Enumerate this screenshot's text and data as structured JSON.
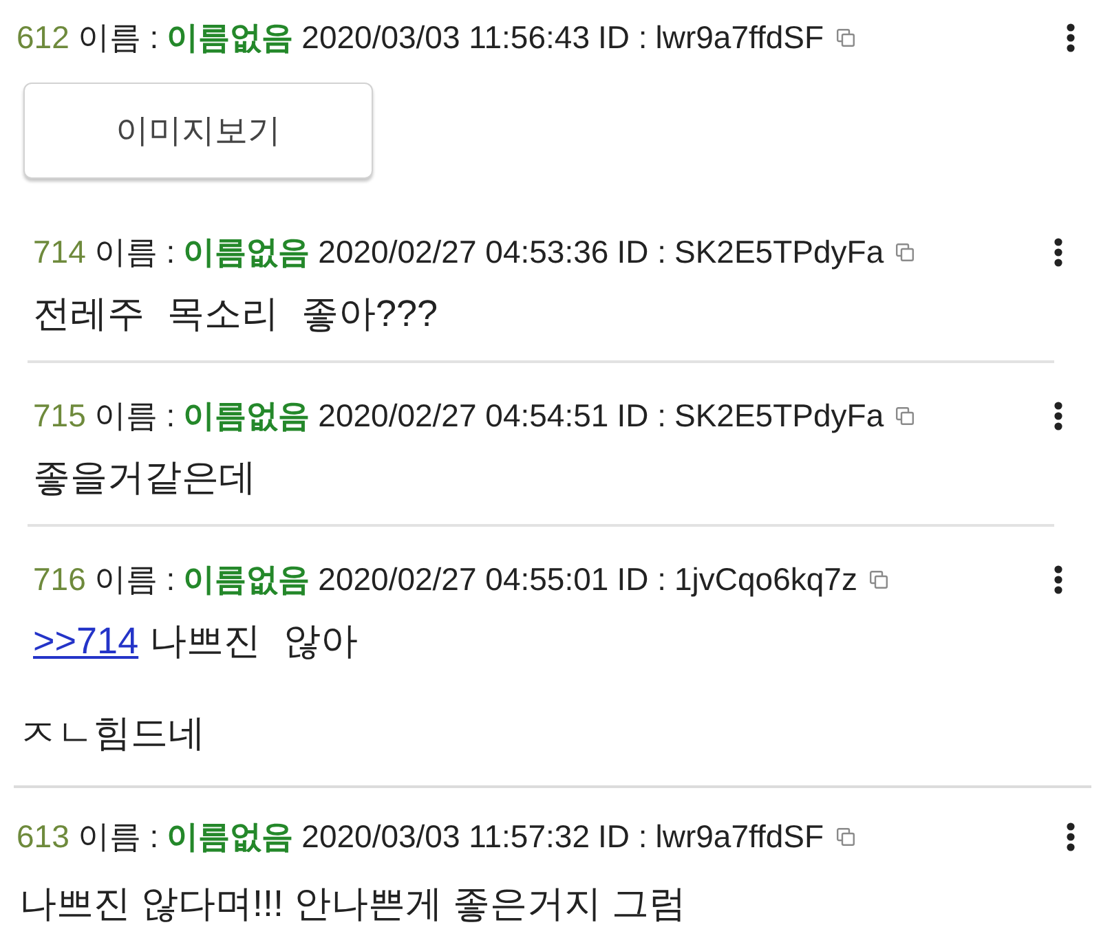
{
  "posts": [
    {
      "number": "612",
      "name_label": "이름 :",
      "name": "이름없음",
      "date": "2020/03/03 11:56:43",
      "id_label": "ID :",
      "id": "lwr9a7ffdSF",
      "image_button": "이미지보기",
      "quotes": [
        {
          "number": "714",
          "name_label": "이름 :",
          "name": "이름없음",
          "date": "2020/02/27 04:53:36",
          "id_label": "ID :",
          "id": "SK2E5TPdyFa",
          "body": [
            {
              "kind": "text",
              "text": "전레주 목소리 좋아???"
            }
          ]
        },
        {
          "number": "715",
          "name_label": "이름 :",
          "name": "이름없음",
          "date": "2020/02/27 04:54:51",
          "id_label": "ID :",
          "id": "SK2E5TPdyFa",
          "body": [
            {
              "kind": "text",
              "text": "좋을거같은데"
            }
          ]
        },
        {
          "number": "716",
          "name_label": "이름 :",
          "name": "이름없음",
          "date": "2020/02/27 04:55:01",
          "id_label": "ID :",
          "id": "1jvCqo6kq7z",
          "body": [
            {
              "kind": "link",
              "text": ">>714"
            },
            {
              "kind": "text",
              "text": "나쁘진 않아"
            }
          ]
        }
      ],
      "body": [
        {
          "kind": "text",
          "text": "ㅈㄴ힘드네"
        }
      ]
    },
    {
      "number": "613",
      "name_label": "이름 :",
      "name": "이름없음",
      "date": "2020/03/03 11:57:32",
      "id_label": "ID :",
      "id": "lwr9a7ffdSF",
      "body": [
        {
          "kind": "text",
          "text": "나쁘진 않다며!!! 안나쁜게 좋은거지 그럼"
        }
      ]
    }
  ]
}
